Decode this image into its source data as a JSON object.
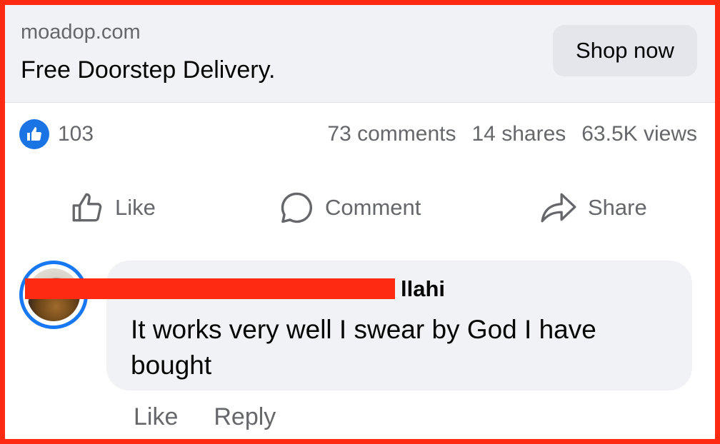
{
  "ad": {
    "domain": "moadop.com",
    "headline": "Free Doorstep Delivery.",
    "cta_label": "Shop now"
  },
  "stats": {
    "reaction_count": "103",
    "comments": "73 comments",
    "shares": "14 shares",
    "views": "63.5K views"
  },
  "actions": {
    "like": "Like",
    "comment": "Comment",
    "share": "Share"
  },
  "comment": {
    "author_visible": "llahi",
    "text": "It works very well I swear by God I have bought",
    "like_label": "Like",
    "reply_label": "Reply"
  },
  "colors": {
    "frame_border": "#ff2a12",
    "redaction": "#ff2a12",
    "accent_blue": "#1877f2",
    "secondary_text": "#65676b",
    "panel_bg": "#f0f2f5",
    "button_bg": "#e4e6eb"
  },
  "icons": [
    "like-reaction-icon",
    "thumbs-up-icon",
    "comment-icon",
    "share-arrow-icon"
  ]
}
